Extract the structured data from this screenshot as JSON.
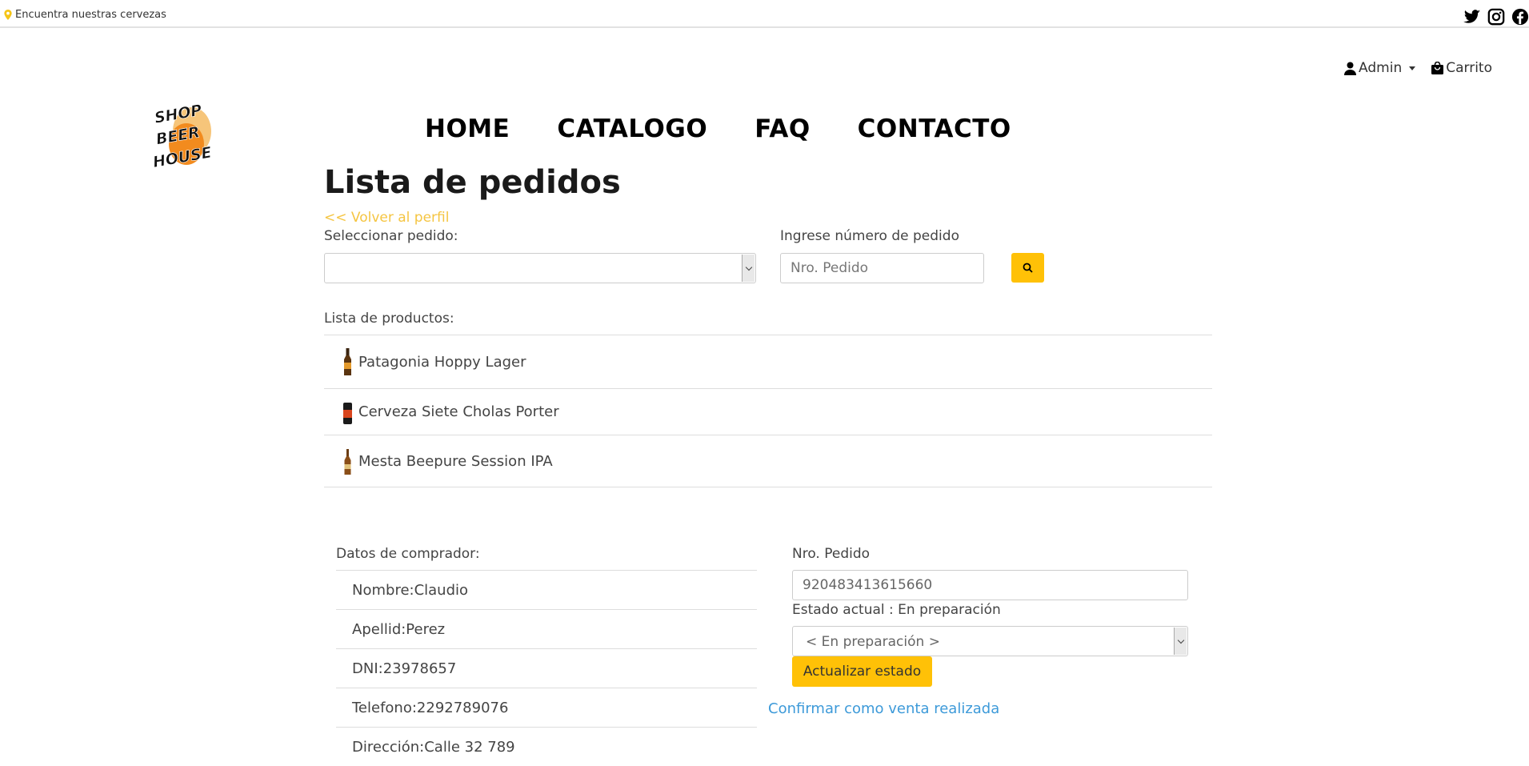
{
  "topbar": {
    "location_text": "Encuentra nuestras cervezas",
    "social": [
      "twitter-icon",
      "instagram-icon",
      "facebook-icon"
    ]
  },
  "header": {
    "user_label": "Admin",
    "cart_label": "Carrito",
    "logo_text": "SHOP BEER HOUSE"
  },
  "nav": [
    "HOME",
    "CATALOGO",
    "FAQ",
    "CONTACTO"
  ],
  "page": {
    "title": "Lista de pedidos",
    "back_link": "<< Volver al perfil"
  },
  "filters": {
    "select_label": "Seleccionar pedido:",
    "select_value": "",
    "number_label": "Ingrese número de pedido",
    "number_placeholder": "Nro. Pedido"
  },
  "products": {
    "label": "Lista de productos:",
    "items": [
      "Patagonia Hoppy Lager",
      "Cerveza Siete Cholas Porter",
      "Mesta Beepure Session IPA"
    ]
  },
  "buyer": {
    "label": "Datos de comprador:",
    "rows": [
      "Nombre:Claudio",
      "Apellid:Perez",
      "DNI:23978657",
      "Telefono:2292789076",
      "Dirección:Calle 32 789"
    ]
  },
  "order": {
    "number_label": "Nro. Pedido",
    "number_value": "920483413615660",
    "status_label": "Estado actual : En preparación",
    "status_select": "< En preparación >",
    "update_button": "Actualizar estado",
    "confirm_link": "Confirmar como venta realizada"
  },
  "colors": {
    "accent": "#ffc107",
    "link": "#3d9ad9",
    "back_link": "#f5c542"
  }
}
